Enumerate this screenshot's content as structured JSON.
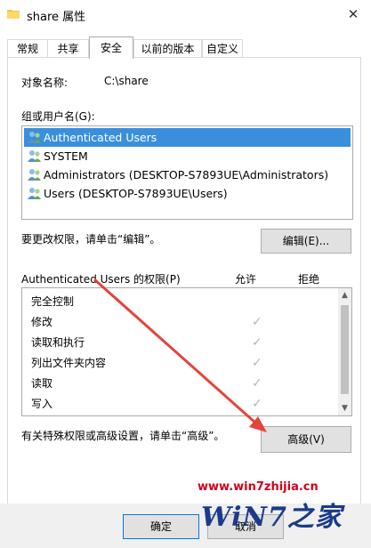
{
  "window": {
    "title": "share 属性",
    "close_glyph": "✕"
  },
  "tabs": [
    {
      "label": "常规"
    },
    {
      "label": "共享"
    },
    {
      "label": "安全"
    },
    {
      "label": "以前的版本"
    },
    {
      "label": "自定义"
    }
  ],
  "active_tab": "安全",
  "object": {
    "label": "对象名称:",
    "value": "C:\\share"
  },
  "groups": {
    "label": "组或用户名(G):",
    "items": [
      {
        "name": "Authenticated Users",
        "selected": true
      },
      {
        "name": "SYSTEM",
        "selected": false
      },
      {
        "name": "Administrators (DESKTOP-S7893UE\\Administrators)",
        "selected": false
      },
      {
        "name": "Users (DESKTOP-S7893UE\\Users)",
        "selected": false
      }
    ]
  },
  "edit_hint": "要更改权限，请单击“编辑”。",
  "edit_button": "编辑(E)...",
  "permissions": {
    "label": "Authenticated Users 的权限(P)",
    "allow_header": "允许",
    "deny_header": "拒绝",
    "check_glyph": "✓",
    "rows": [
      {
        "name": "完全控制",
        "allow": false
      },
      {
        "name": "修改",
        "allow": true
      },
      {
        "name": "读取和执行",
        "allow": true
      },
      {
        "name": "列出文件夹内容",
        "allow": true
      },
      {
        "name": "读取",
        "allow": true
      },
      {
        "name": "写入",
        "allow": true
      }
    ]
  },
  "advanced_hint": "有关特殊权限或高级设置，请单击“高级”。",
  "advanced_button": "高级(V)",
  "ok_button": "确定",
  "cancel_button": "取消",
  "watermark": {
    "url": "www.win7zhijia.cn",
    "logo": "WiN7之家"
  },
  "colors": {
    "selection": "#3a8fdc",
    "annotation_arrow": "#e2453a",
    "watermark_red": "#d0021b"
  }
}
